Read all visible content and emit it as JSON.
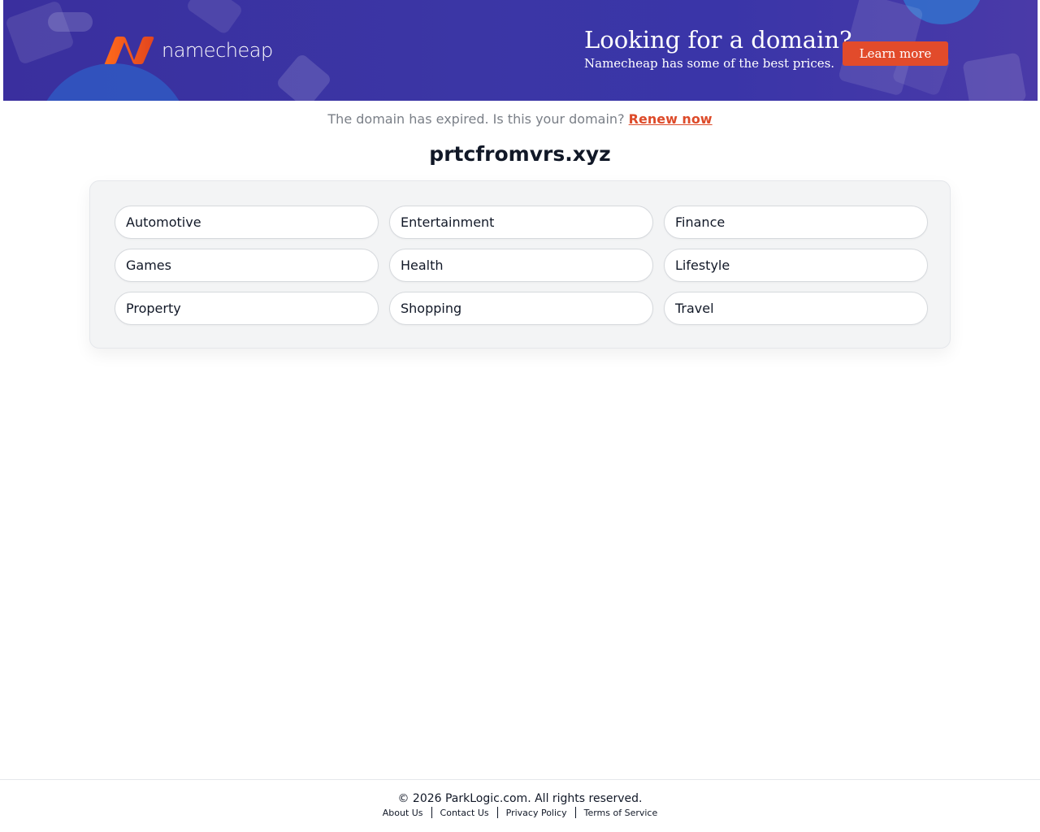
{
  "banner": {
    "logo_text": "namecheap",
    "promo_title": "Looking for a domain?",
    "promo_subtitle": "Namecheap has some of the best prices.",
    "learn_more_label": "Learn more"
  },
  "notice": {
    "text": "The domain has expired. Is this your domain?",
    "link_label": "Renew now"
  },
  "domain_name": "prtcfromvrs.xyz",
  "categories": [
    "Automotive",
    "Entertainment",
    "Finance",
    "Games",
    "Health",
    "Lifestyle",
    "Property",
    "Shopping",
    "Travel"
  ],
  "footer": {
    "copyright": "© 2026 ParkLogic.com. All rights reserved.",
    "links": [
      "About Us",
      "Contact Us",
      "Privacy Policy",
      "Terms of Service"
    ]
  },
  "colors": {
    "banner_bg": "#3b36a5",
    "accent_orange": "#e24b2b",
    "link_red": "#dd4b2a"
  }
}
